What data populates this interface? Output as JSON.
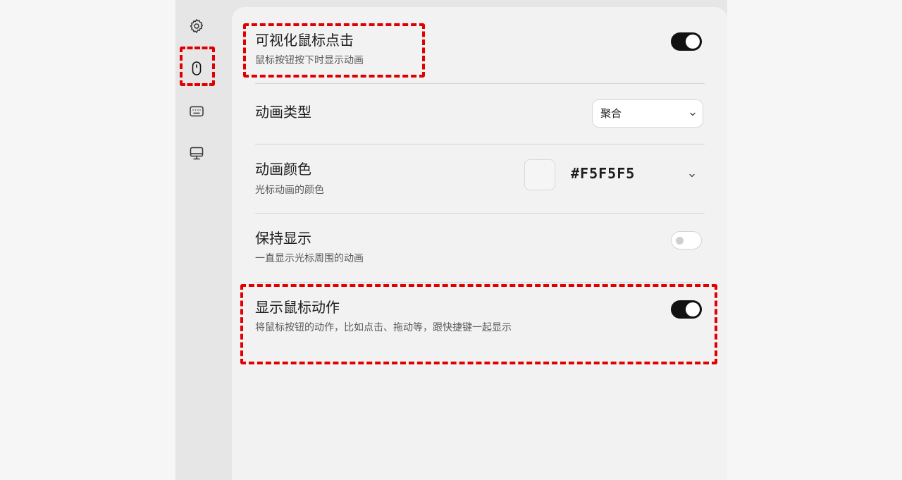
{
  "sidebar": {
    "items": [
      {
        "icon": "gear-icon"
      },
      {
        "icon": "mouse-icon",
        "active": true
      },
      {
        "icon": "keyboard-icon"
      },
      {
        "icon": "monitor-icon"
      }
    ]
  },
  "settings": {
    "visualize_click": {
      "title": "可视化鼠标点击",
      "desc": "鼠标按钮按下时显示动画",
      "enabled": true
    },
    "animation_type": {
      "title": "动画类型",
      "value": "聚合"
    },
    "animation_color": {
      "title": "动画颜色",
      "desc": "光标动画的颜色",
      "hex": "#F5F5F5"
    },
    "keep_showing": {
      "title": "保持显示",
      "desc": "一直显示光标周围的动画",
      "enabled": false
    },
    "show_mouse_actions": {
      "title": "显示鼠标动作",
      "desc": "将鼠标按钮的动作，比如点击、拖动等，跟快捷键一起显示",
      "enabled": true
    }
  },
  "colors": {
    "highlight": "#E00000",
    "toggle_on": "#111111",
    "swatch": "#F5F5F5"
  }
}
